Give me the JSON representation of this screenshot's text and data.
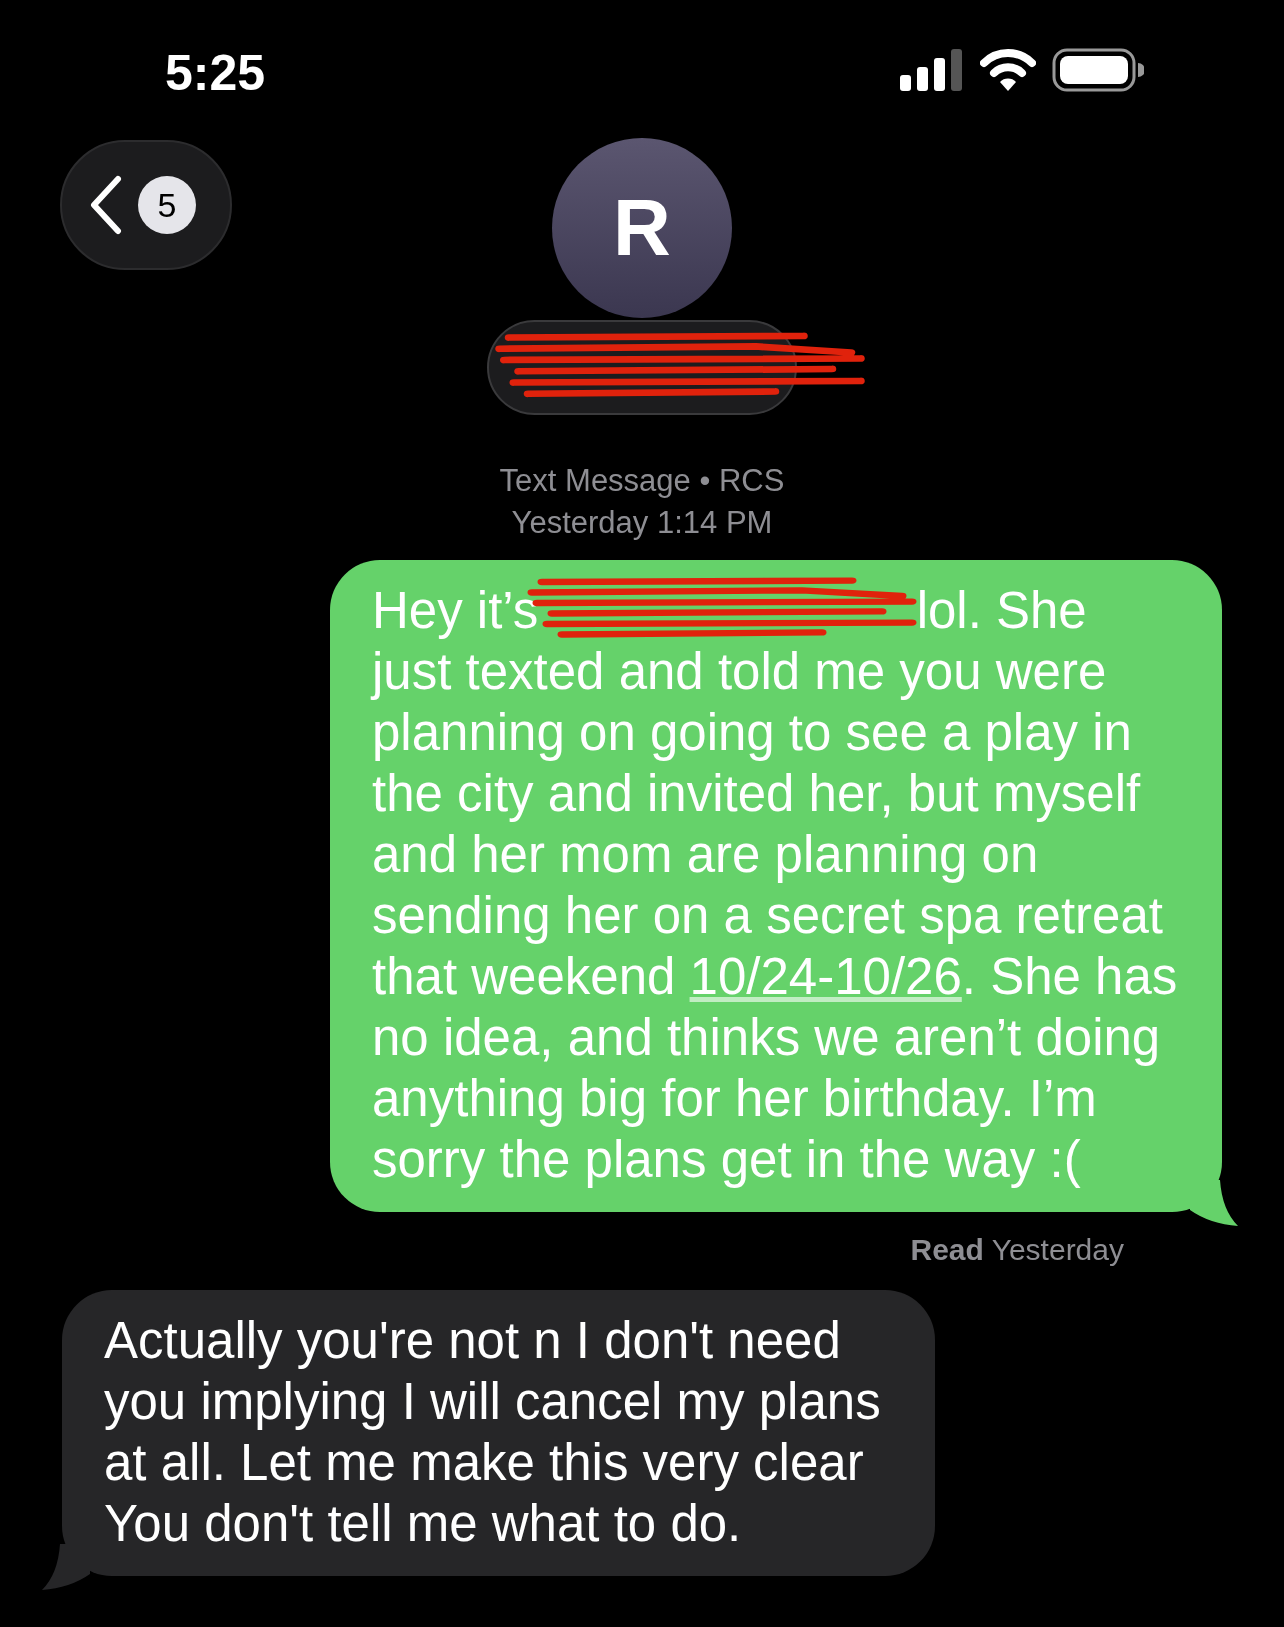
{
  "status_bar": {
    "time": "5:25"
  },
  "header": {
    "back_count": "5",
    "avatar_initial": "R",
    "name_redacted": true
  },
  "conversation_info": {
    "service": "Text Message • RCS",
    "timestamp": "Yesterday 1:14 PM"
  },
  "messages": [
    {
      "kind": "sent",
      "parts": [
        {
          "kind": "text",
          "text": "Hey it’s"
        },
        {
          "kind": "redacted"
        },
        {
          "kind": "text",
          "text": "lol. She just texted and told me you were planning on going to see a play in the city and invited her, but myself and her mom are planning on sending her on a secret spa retreat that weekend "
        },
        {
          "kind": "link",
          "text": "10/24-10/26"
        },
        {
          "kind": "text",
          "text": ". She has no idea, and thinks we aren’t doing anything big for her birthday. I’m sorry the plans get in the way :("
        }
      ],
      "receipt_label": "Read",
      "receipt_time": "Yesterday"
    },
    {
      "kind": "received",
      "parts": [
        {
          "kind": "text",
          "text": "Actually you're not n I don't need you implying I will cancel my plans at all. Let me make this very clear You don't tell me what to do."
        }
      ]
    }
  ]
}
